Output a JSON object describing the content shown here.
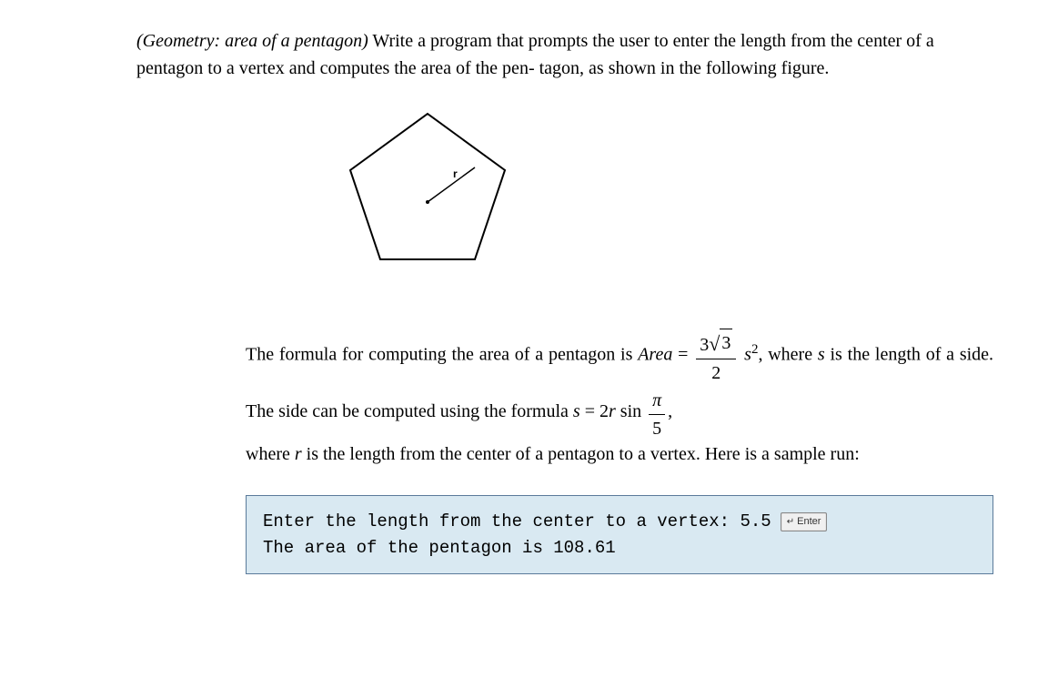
{
  "problem": {
    "title_italic": "(Geometry: area of a pentagon)",
    "statement_1": " Write a program that prompts the user to enter the length from the center of a pentagon to a vertex and computes the area of the pen- tagon, as shown in the following figure."
  },
  "pentagon": {
    "label_r": "r"
  },
  "formula": {
    "line1_part1": "The formula for computing the area of a pentagon is ",
    "area_word": "Area",
    "equals1": " = ",
    "frac1_top_a": "3",
    "frac1_top_b": "3",
    "frac1_bottom": "2",
    "s_squared": "s",
    "sup2": "2",
    "line1_part2": ", where ",
    "s_word": "s",
    "line1_part3": " is",
    "line2_part1": "the length of a side. The side can be computed using the formula ",
    "s_word2": "s",
    "equals2": " = 2",
    "r_word": "r",
    "sin_word": " sin ",
    "frac2_top": "π",
    "frac2_bottom": "5",
    "comma": ",",
    "line3_part1": "where ",
    "r_word2": "r",
    "line3_part2": " is the length from the center of a pentagon to a vertex. Here is a sample run:"
  },
  "sample_run": {
    "line1_prompt": "Enter the length from the center to a vertex: ",
    "line1_input": "5.5",
    "enter_label": "Enter",
    "line2": "The area of the pentagon is 108.61"
  }
}
